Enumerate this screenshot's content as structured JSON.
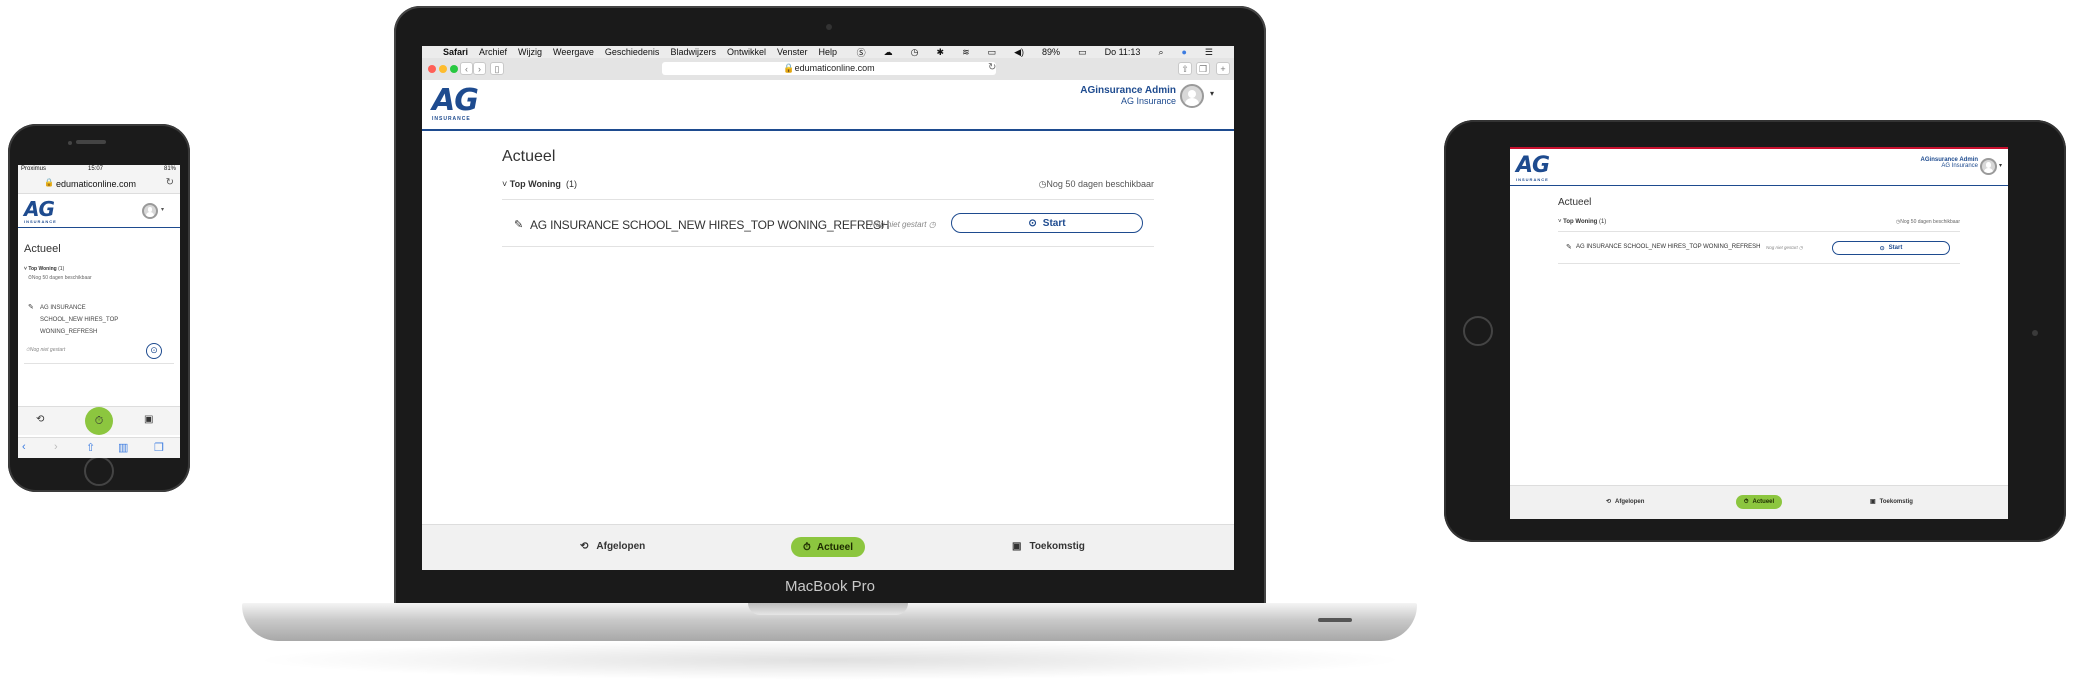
{
  "laptop": {
    "brand": "MacBook Pro",
    "menubar": {
      "apple": "",
      "items": [
        "Safari",
        "Archief",
        "Wijzig",
        "Weergave",
        "Geschiedenis",
        "Bladwijzers",
        "Ontwikkel",
        "Venster",
        "Help"
      ],
      "battery": "89%",
      "clock": "Do 11:13"
    },
    "browser": {
      "url": "edumaticonline.com"
    },
    "header": {
      "user_name": "AGinsurance Admin",
      "company": "AG Insurance"
    },
    "logo": {
      "mark": "AG",
      "word": "INSURANCE"
    },
    "page_title": "Actueel",
    "group": {
      "toggle": "˅",
      "name": "Top Woning",
      "count": "(1)",
      "availability": "Nog 50 dagen beschikbaar"
    },
    "course": {
      "title": "AG INSURANCE SCHOOL_NEW HIRES_TOP WONING_REFRESH",
      "status": "Nog niet gestart",
      "start_label": "Start"
    },
    "bottom_nav": {
      "past": "Afgelopen",
      "current": "Actueel",
      "future": "Toekomstig"
    }
  },
  "phone": {
    "status_left": "Proximus",
    "status_time": "15:07",
    "status_right": "81%",
    "url": "edumaticonline.com",
    "logo": {
      "mark": "AG",
      "word": "INSURANCE"
    },
    "page_title": "Actueel",
    "group": {
      "name": "Top Woning",
      "count": "(1)",
      "availability": "Nog 50 dagen beschikbaar"
    },
    "course_lines": [
      "AG INSURANCE",
      "SCHOOL_NEW HIRES_TOP",
      "WONING_REFRESH"
    ],
    "course_status": "Nog niet gestart"
  },
  "tablet": {
    "header": {
      "user_name": "AGinsurance Admin",
      "company": "AG Insurance"
    },
    "logo": {
      "mark": "AG",
      "word": "INSURANCE"
    },
    "page_title": "Actueel",
    "group": {
      "name": "Top Woning",
      "count": "(1)",
      "availability": "Nog 50 dagen beschikbaar"
    },
    "course": {
      "title": "AG INSURANCE SCHOOL_NEW HIRES_TOP WONING_REFRESH",
      "status": "Nog niet gestart",
      "start_label": "Start"
    },
    "bottom_nav": {
      "past": "Afgelopen",
      "current": "Actueel",
      "future": "Toekomstig"
    }
  },
  "colors": {
    "brand_blue": "#1e4b8f",
    "brand_green": "#8cc63f",
    "tablet_accent": "#c8102e"
  },
  "icons": [
    "apple-icon",
    "pencil-icon",
    "play-circle-icon",
    "clock-icon",
    "history-icon",
    "stopwatch-icon",
    "calendar-icon",
    "chevron-down-icon",
    "reload-icon",
    "lock-icon",
    "share-icon",
    "tabs-icon",
    "sidebar-icon",
    "back-icon",
    "forward-icon",
    "bookmarks-icon"
  ]
}
